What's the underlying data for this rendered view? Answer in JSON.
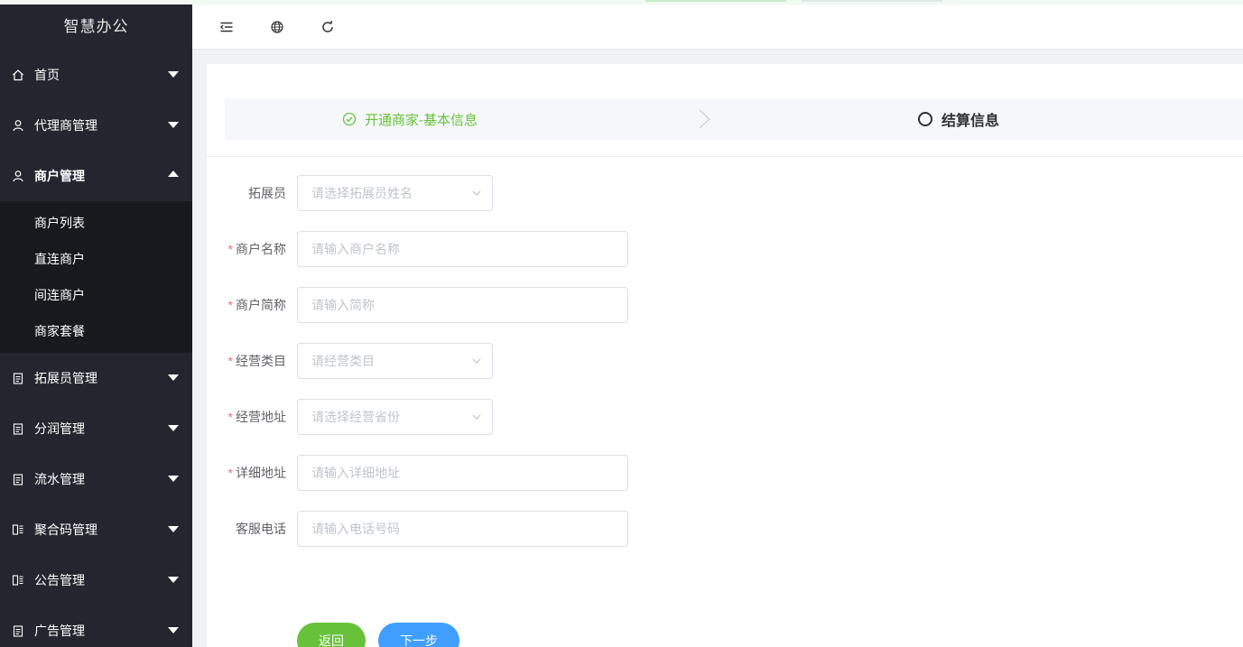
{
  "app": {
    "brand": "智慧办公"
  },
  "sidebar": {
    "items": [
      {
        "label": "首页",
        "icon": "home-icon"
      },
      {
        "label": "代理商管理",
        "icon": "user-icon"
      },
      {
        "label": "商户管理",
        "icon": "user-icon",
        "open": true,
        "children": [
          "商户列表",
          "直连商户",
          "间连商户",
          "商家套餐"
        ]
      },
      {
        "label": "拓展员管理",
        "icon": "clipboard-icon"
      },
      {
        "label": "分润管理",
        "icon": "clipboard-icon"
      },
      {
        "label": "流水管理",
        "icon": "clipboard-icon"
      },
      {
        "label": "聚合码管理",
        "icon": "qrcode-icon"
      },
      {
        "label": "公告管理",
        "icon": "qrcode-icon"
      },
      {
        "label": "广告管理",
        "icon": "clipboard-icon"
      }
    ]
  },
  "header": {
    "buttons": [
      "menu-fold-icon",
      "globe-icon",
      "refresh-icon"
    ]
  },
  "steps": {
    "step1": "开通商家-基本信息",
    "step2": "结算信息"
  },
  "form": {
    "fields": [
      {
        "label": "拓展员",
        "required": false,
        "type": "select",
        "placeholder": "请选择拓展员姓名"
      },
      {
        "label": "商户名称",
        "required": true,
        "type": "text",
        "placeholder": "请输入商户名称"
      },
      {
        "label": "商户简称",
        "required": true,
        "type": "text",
        "placeholder": "请输入简称"
      },
      {
        "label": "经营类目",
        "required": true,
        "type": "select",
        "placeholder": "请经营类目"
      },
      {
        "label": "经营地址",
        "required": true,
        "type": "select",
        "placeholder": "请选择经营省份"
      },
      {
        "label": "详细地址",
        "required": true,
        "type": "text",
        "placeholder": "请输入详细地址"
      },
      {
        "label": "客服电话",
        "required": false,
        "type": "text",
        "placeholder": "请输入电话号码"
      }
    ],
    "back_label": "返回",
    "next_label": "下一步"
  },
  "colors": {
    "sidebar_bg": "#23262e",
    "submenu_bg": "#17191f",
    "success": "#67c23a",
    "primary": "#409eff",
    "required": "#f56c6c"
  }
}
